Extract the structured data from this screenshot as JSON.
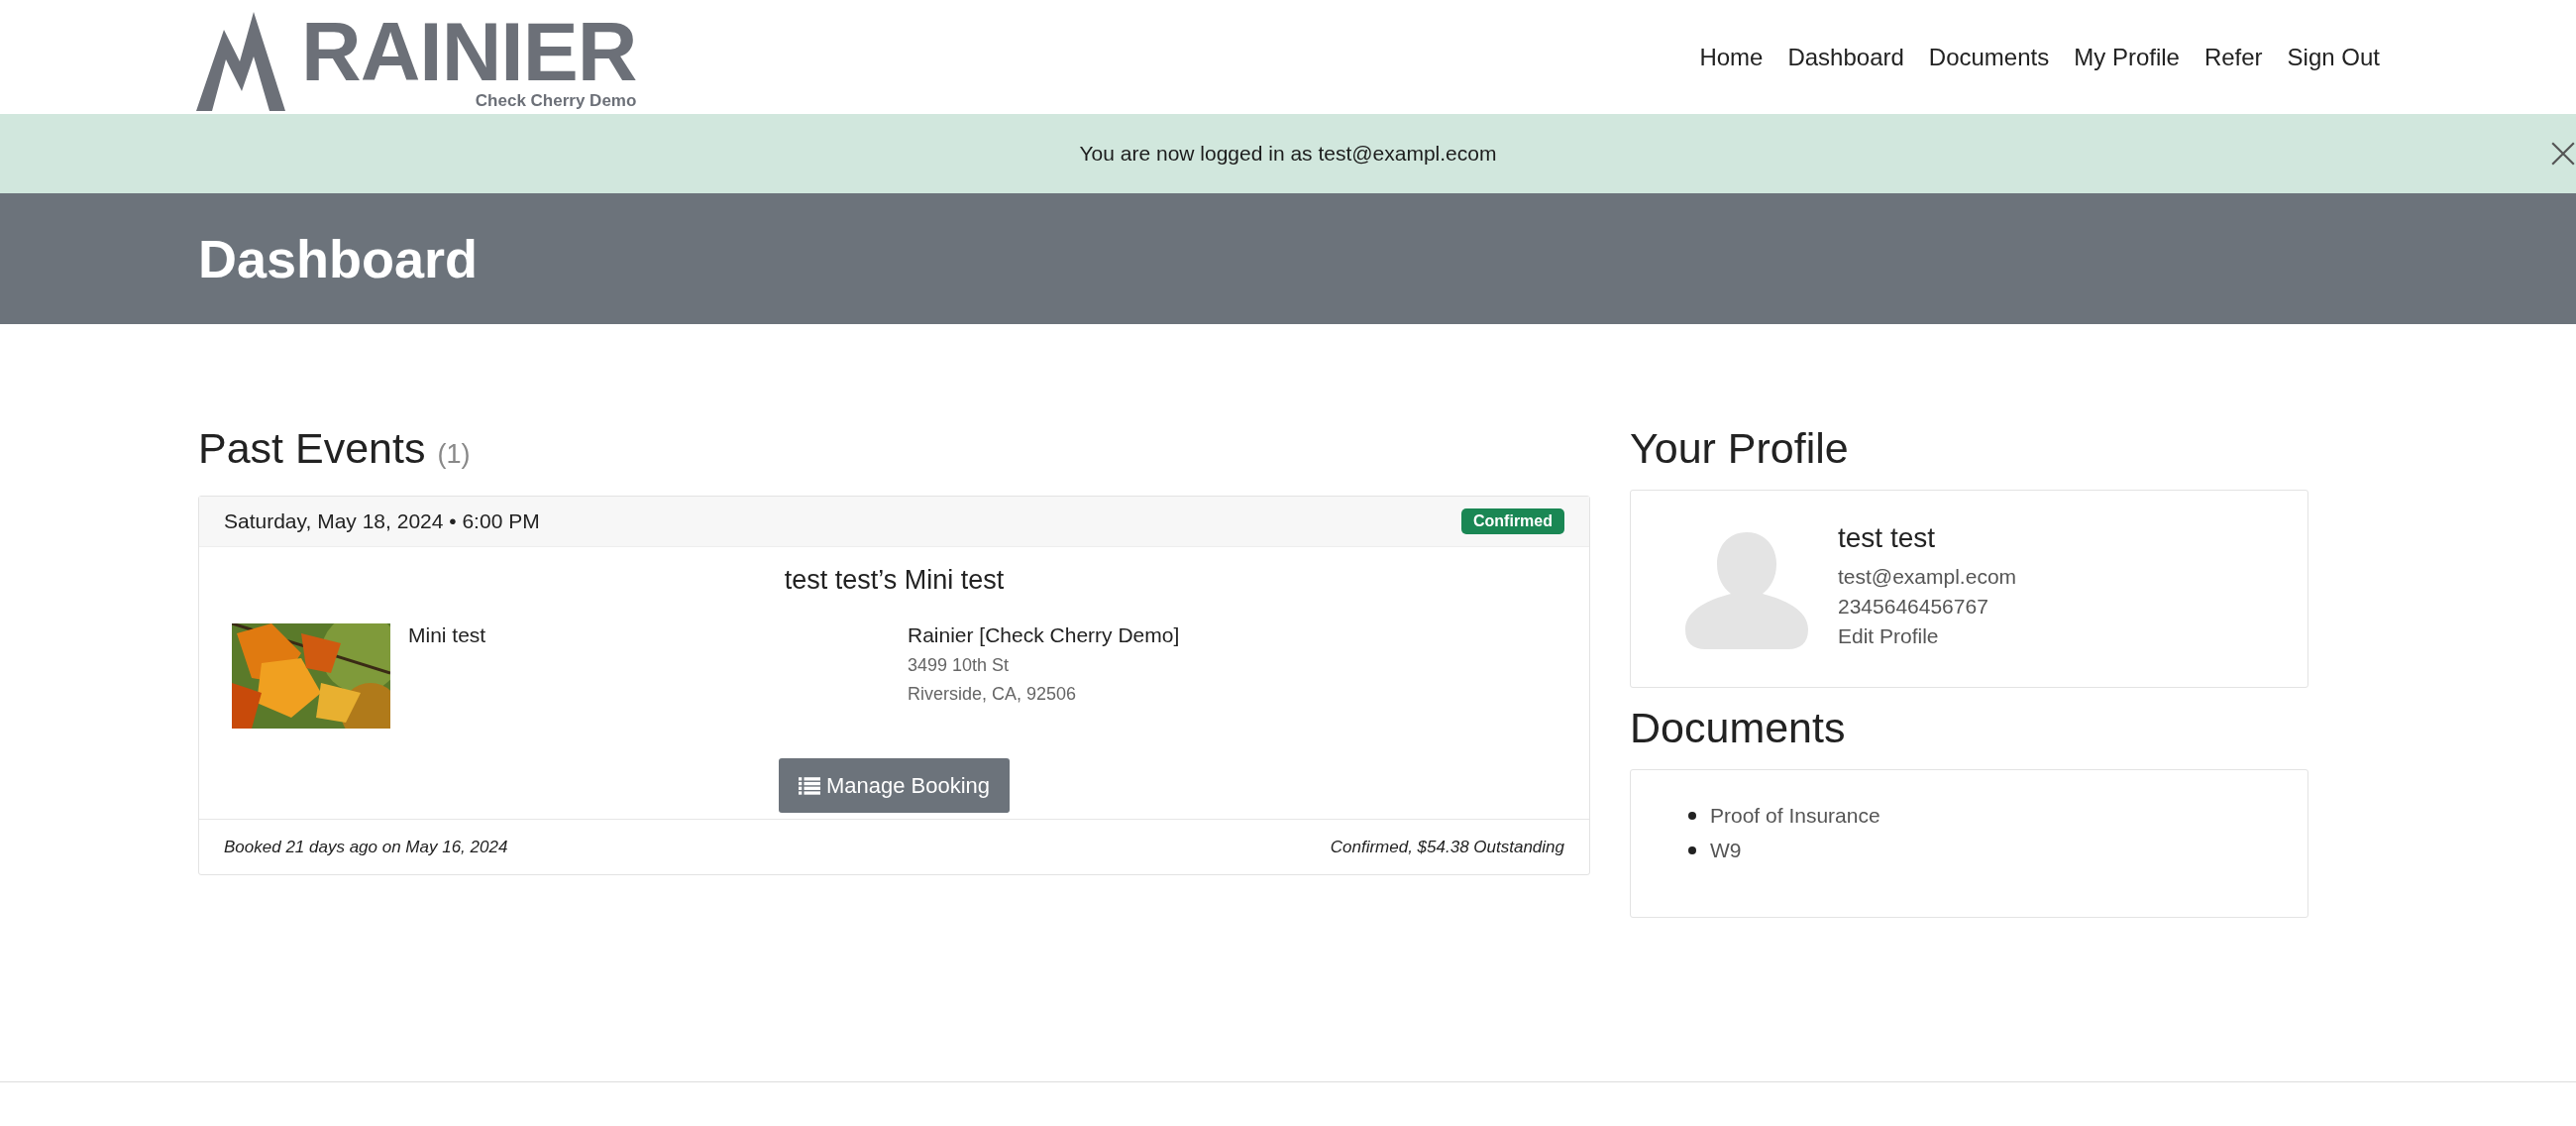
{
  "logo": {
    "name": "RAINIER",
    "subtitle": "Check Cherry Demo"
  },
  "nav": [
    {
      "label": "Home"
    },
    {
      "label": "Dashboard"
    },
    {
      "label": "Documents"
    },
    {
      "label": "My Profile"
    },
    {
      "label": "Refer"
    },
    {
      "label": "Sign Out"
    }
  ],
  "alert": {
    "message": "You are now logged in as test@exampl.ecom"
  },
  "page_title": "Dashboard",
  "past_events": {
    "heading": "Past Events",
    "count": "(1)",
    "events": [
      {
        "date": "Saturday, May 18, 2024 • 6:00 PM",
        "status": "Confirmed",
        "color": "#1a8754",
        "title": "test test’s Mini test",
        "package": "Mini test",
        "venue": "Rainier [Check Cherry Demo]",
        "address_line_1": "3499 10th St",
        "address_line_2": "Riverside, CA, 92506",
        "button": "Manage Booking",
        "booked": "Booked 21 days ago on May 16, 2024",
        "balance": "Confirmed, $54.38 Outstanding"
      }
    ]
  },
  "profile": {
    "heading": "Your Profile",
    "name": "test test",
    "email": "test@exampl.ecom",
    "phone": "2345646456767",
    "edit_link": "Edit Profile"
  },
  "documents": {
    "heading": "Documents",
    "items": [
      "Proof of Insurance",
      "W9"
    ]
  }
}
